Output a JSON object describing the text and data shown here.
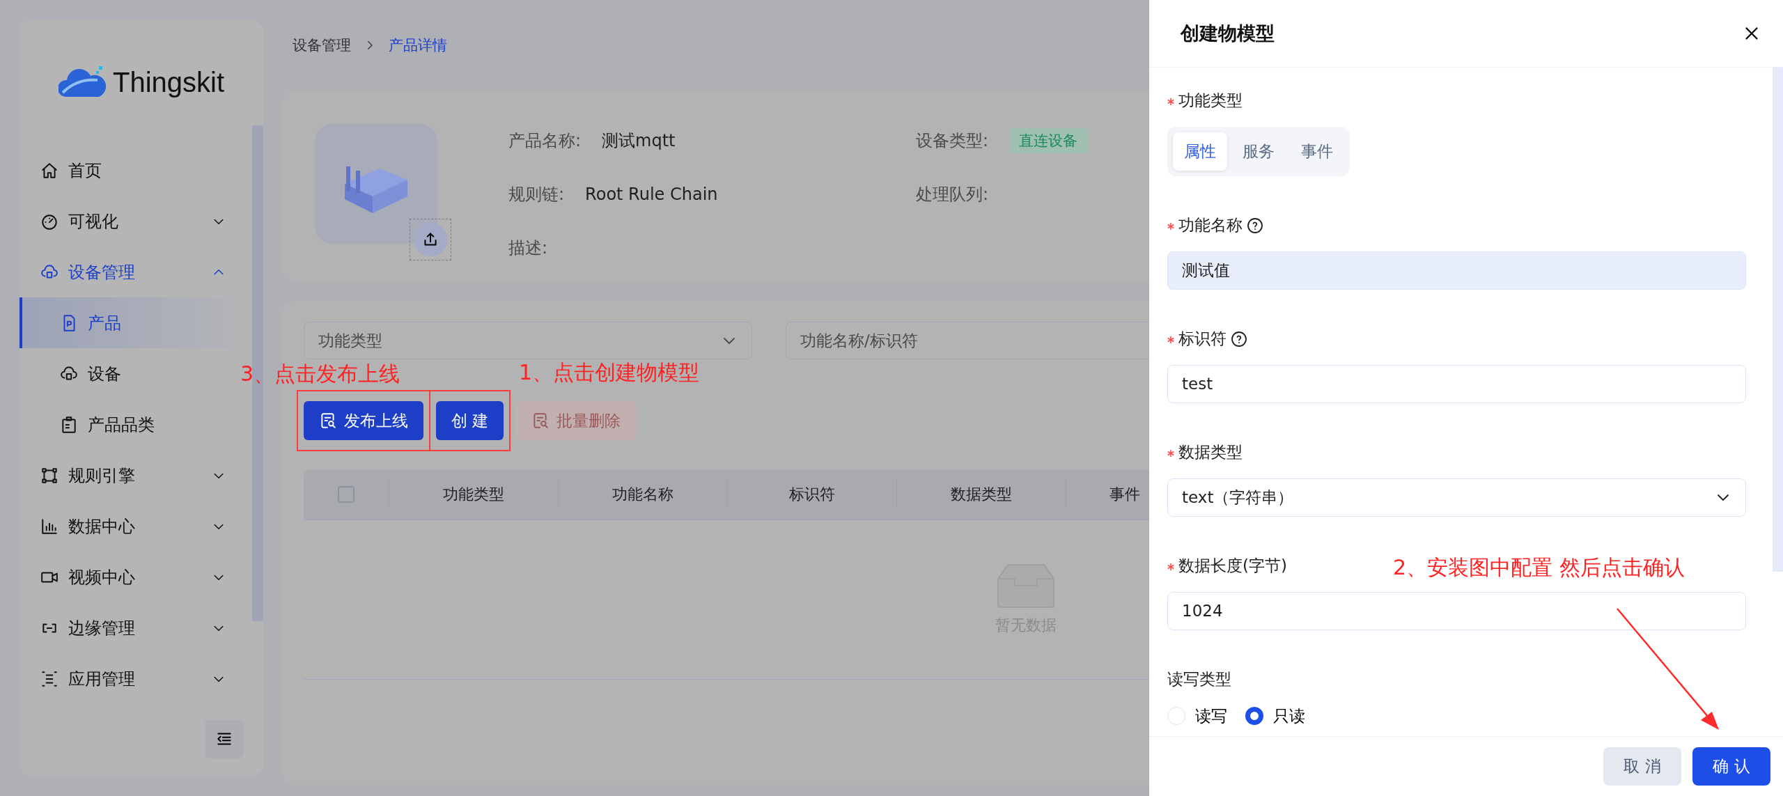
{
  "sidebar": {
    "logo": "Thingskit",
    "menu": [
      {
        "label": "首页",
        "expandable": false,
        "expanded": false,
        "selected": false
      },
      {
        "label": "可视化",
        "expandable": true,
        "expanded": false,
        "selected": false
      },
      {
        "label": "设备管理",
        "expandable": true,
        "expanded": true,
        "selected": true,
        "children": [
          {
            "label": "产品",
            "selected": true
          },
          {
            "label": "设备",
            "selected": false
          },
          {
            "label": "产品品类",
            "selected": false
          }
        ]
      },
      {
        "label": "规则引擎",
        "expandable": true,
        "expanded": false,
        "selected": false
      },
      {
        "label": "数据中心",
        "expandable": true,
        "expanded": false,
        "selected": false
      },
      {
        "label": "视频中心",
        "expandable": true,
        "expanded": false,
        "selected": false
      },
      {
        "label": "边缘管理",
        "expandable": true,
        "expanded": false,
        "selected": false
      },
      {
        "label": "应用管理",
        "expandable": true,
        "expanded": false,
        "selected": false
      }
    ]
  },
  "breadcrumb": [
    "设备管理",
    "产品详情"
  ],
  "product": {
    "fields": [
      {
        "label": "产品名称:",
        "value": "测试mqtt"
      },
      {
        "label": "设备类型:",
        "tag": "直连设备"
      },
      {
        "label": "规则链:",
        "value": "Root Rule Chain"
      },
      {
        "label": "处理队列:"
      },
      {
        "label": "描述:"
      }
    ]
  },
  "filters": {
    "type_select": {
      "placeholder": "功能类型"
    },
    "search": {
      "placeholder": "功能名称/标识符"
    }
  },
  "toolbar": [
    {
      "label": "发布上线",
      "icon": true,
      "disabled": false,
      "highlighted": true
    },
    {
      "label": "创 建",
      "icon": false,
      "disabled": false,
      "highlighted": true
    },
    {
      "label": "批量删除",
      "icon": true,
      "disabled": true,
      "highlighted": false
    }
  ],
  "table": {
    "select_all_checked": false,
    "columns": [
      "功能类型",
      "功能名称",
      "标识符",
      "数据类型",
      "事件"
    ],
    "empty_text": "暂无数据"
  },
  "annotations": [
    {
      "kind": "text",
      "text": "3、点击发布上线"
    },
    {
      "kind": "text",
      "text": "1、点击创建物模型"
    },
    {
      "kind": "text",
      "text": "2、安装图中配置 然后点击确认"
    },
    {
      "kind": "arrow"
    }
  ],
  "drawer": {
    "title": "创建物模型",
    "fields": [
      {
        "kind": "segmented",
        "label": "功能类型",
        "required": true,
        "help": false,
        "options": [
          {
            "label": "属性",
            "selected": true
          },
          {
            "label": "服务",
            "selected": false
          },
          {
            "label": "事件",
            "selected": false
          }
        ]
      },
      {
        "kind": "input",
        "label": "功能名称",
        "required": true,
        "help": true,
        "value": "测试值",
        "focused": true
      },
      {
        "kind": "input",
        "label": "标识符",
        "required": true,
        "help": true,
        "value": "test",
        "focused": false
      },
      {
        "kind": "select",
        "label": "数据类型",
        "required": true,
        "help": false,
        "value": "text（字符串）"
      },
      {
        "kind": "input",
        "label": "数据长度(字节)",
        "required": true,
        "help": false,
        "value": "1024",
        "focused": false
      },
      {
        "kind": "radio",
        "label": "读写类型",
        "required": false,
        "help": false,
        "options": [
          {
            "label": "读写",
            "selected": false
          },
          {
            "label": "只读",
            "selected": true
          }
        ]
      }
    ],
    "buttons": [
      {
        "label": "取 消",
        "primary": false
      },
      {
        "label": "确 认",
        "primary": true
      }
    ]
  }
}
